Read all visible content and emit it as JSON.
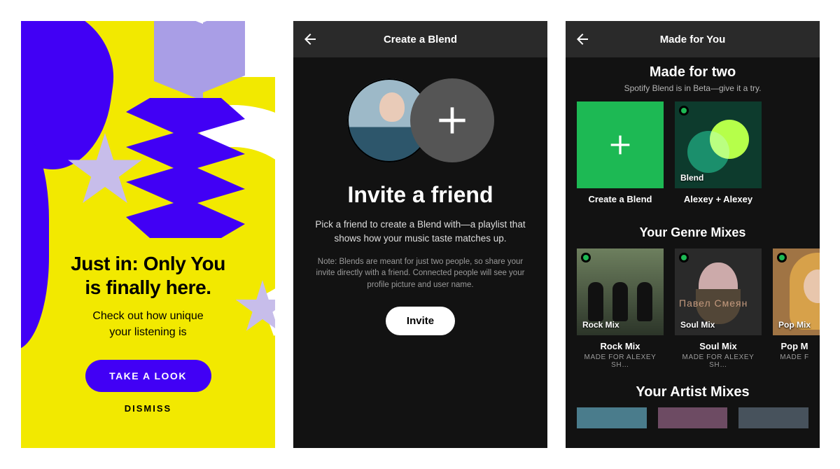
{
  "screen1": {
    "title_line1": "Just in: Only You",
    "title_line2": "is finally here.",
    "subtitle_line1": "Check out how unique",
    "subtitle_line2": "your listening is",
    "cta_label": "TAKE A LOOK",
    "dismiss_label": "DISMISS"
  },
  "screen2": {
    "header_title": "Create a Blend",
    "heading": "Invite a friend",
    "body": "Pick a friend to create a Blend with—a playlist that shows how your music taste matches up.",
    "note": "Note: Blends are meant for just two people, so share your invite directly with a friend. Connected people will see your profile picture and user name.",
    "invite_label": "Invite",
    "icons": {
      "back": "arrow-left",
      "add": "plus"
    }
  },
  "screen3": {
    "header_title": "Made for You",
    "made_for_two": {
      "title": "Made for two",
      "subtitle": "Spotify Blend is in Beta—give it a try.",
      "tiles": [
        {
          "caption": "Create a Blend",
          "overlay_label": "",
          "kind": "create"
        },
        {
          "caption": "Alexey + Alexey",
          "overlay_label": "Blend",
          "kind": "blend"
        }
      ]
    },
    "genre_mixes": {
      "title": "Your Genre Mixes",
      "tiles": [
        {
          "overlay_label": "Rock Mix",
          "caption": "Rock Mix",
          "subcaption": "MADE FOR ALEXEY SH…"
        },
        {
          "overlay_label": "Soul Mix",
          "caption": "Soul Mix",
          "subcaption": "MADE FOR ALEXEY SH…"
        },
        {
          "overlay_label": "Pop Mix",
          "caption": "Pop M",
          "subcaption": "MADE F"
        }
      ]
    },
    "artist_mixes": {
      "title": "Your Artist Mixes"
    },
    "icons": {
      "back": "arrow-left",
      "plus": "plus",
      "spotify": "spotify-badge"
    }
  },
  "colors": {
    "accent_purple": "#4100F5",
    "only_you_yellow": "#f2e900",
    "spotify_green": "#1db954",
    "dark_bg": "#121212"
  }
}
